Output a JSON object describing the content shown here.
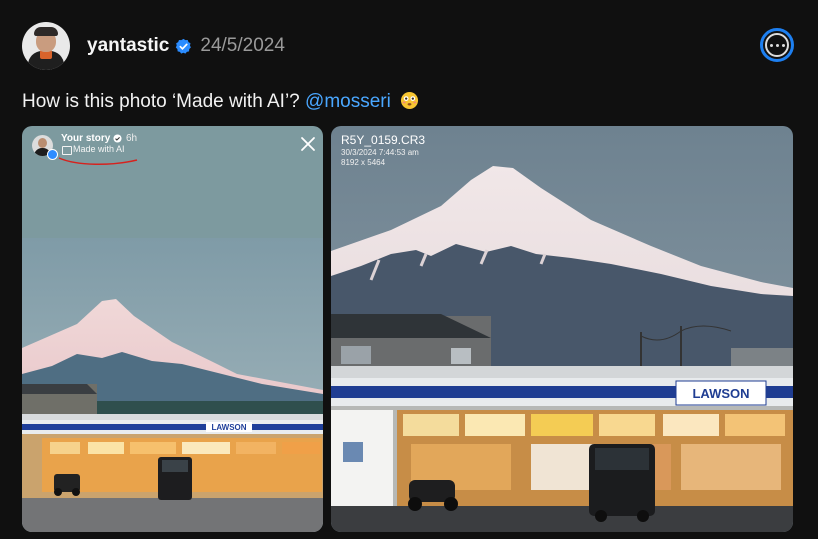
{
  "post": {
    "username": "yantastic",
    "date": "24/5/2024",
    "caption_text": "How is this photo ‘Made with AI’? ",
    "mention": "@mosseri"
  },
  "left_photo": {
    "story_title": "Your story",
    "story_time": "6h",
    "made_with_ai_label": "Made with AI",
    "store_sign": "LAWSON"
  },
  "right_photo": {
    "filename": "R5Y_0159.CR3",
    "timestamp": "30/3/2024 7:44:53 am",
    "dimensions": "8192 x 5464",
    "store_sign": "LAWSON"
  },
  "colors": {
    "accent": "#1d7ff0",
    "mention": "#4aa7ff",
    "annotation": "#d6221e",
    "verified": "#2b8cff"
  }
}
